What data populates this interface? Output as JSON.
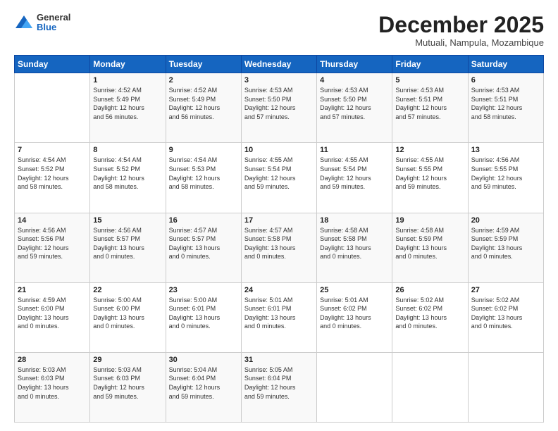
{
  "logo": {
    "general": "General",
    "blue": "Blue"
  },
  "header": {
    "month": "December 2025",
    "location": "Mutuali, Nampula, Mozambique"
  },
  "weekdays": [
    "Sunday",
    "Monday",
    "Tuesday",
    "Wednesday",
    "Thursday",
    "Friday",
    "Saturday"
  ],
  "weeks": [
    [
      {
        "day": "",
        "info": ""
      },
      {
        "day": "1",
        "info": "Sunrise: 4:52 AM\nSunset: 5:49 PM\nDaylight: 12 hours\nand 56 minutes."
      },
      {
        "day": "2",
        "info": "Sunrise: 4:52 AM\nSunset: 5:49 PM\nDaylight: 12 hours\nand 56 minutes."
      },
      {
        "day": "3",
        "info": "Sunrise: 4:53 AM\nSunset: 5:50 PM\nDaylight: 12 hours\nand 57 minutes."
      },
      {
        "day": "4",
        "info": "Sunrise: 4:53 AM\nSunset: 5:50 PM\nDaylight: 12 hours\nand 57 minutes."
      },
      {
        "day": "5",
        "info": "Sunrise: 4:53 AM\nSunset: 5:51 PM\nDaylight: 12 hours\nand 57 minutes."
      },
      {
        "day": "6",
        "info": "Sunrise: 4:53 AM\nSunset: 5:51 PM\nDaylight: 12 hours\nand 58 minutes."
      }
    ],
    [
      {
        "day": "7",
        "info": "Sunrise: 4:54 AM\nSunset: 5:52 PM\nDaylight: 12 hours\nand 58 minutes."
      },
      {
        "day": "8",
        "info": "Sunrise: 4:54 AM\nSunset: 5:52 PM\nDaylight: 12 hours\nand 58 minutes."
      },
      {
        "day": "9",
        "info": "Sunrise: 4:54 AM\nSunset: 5:53 PM\nDaylight: 12 hours\nand 58 minutes."
      },
      {
        "day": "10",
        "info": "Sunrise: 4:55 AM\nSunset: 5:54 PM\nDaylight: 12 hours\nand 59 minutes."
      },
      {
        "day": "11",
        "info": "Sunrise: 4:55 AM\nSunset: 5:54 PM\nDaylight: 12 hours\nand 59 minutes."
      },
      {
        "day": "12",
        "info": "Sunrise: 4:55 AM\nSunset: 5:55 PM\nDaylight: 12 hours\nand 59 minutes."
      },
      {
        "day": "13",
        "info": "Sunrise: 4:56 AM\nSunset: 5:55 PM\nDaylight: 12 hours\nand 59 minutes."
      }
    ],
    [
      {
        "day": "14",
        "info": "Sunrise: 4:56 AM\nSunset: 5:56 PM\nDaylight: 12 hours\nand 59 minutes."
      },
      {
        "day": "15",
        "info": "Sunrise: 4:56 AM\nSunset: 5:57 PM\nDaylight: 13 hours\nand 0 minutes."
      },
      {
        "day": "16",
        "info": "Sunrise: 4:57 AM\nSunset: 5:57 PM\nDaylight: 13 hours\nand 0 minutes."
      },
      {
        "day": "17",
        "info": "Sunrise: 4:57 AM\nSunset: 5:58 PM\nDaylight: 13 hours\nand 0 minutes."
      },
      {
        "day": "18",
        "info": "Sunrise: 4:58 AM\nSunset: 5:58 PM\nDaylight: 13 hours\nand 0 minutes."
      },
      {
        "day": "19",
        "info": "Sunrise: 4:58 AM\nSunset: 5:59 PM\nDaylight: 13 hours\nand 0 minutes."
      },
      {
        "day": "20",
        "info": "Sunrise: 4:59 AM\nSunset: 5:59 PM\nDaylight: 13 hours\nand 0 minutes."
      }
    ],
    [
      {
        "day": "21",
        "info": "Sunrise: 4:59 AM\nSunset: 6:00 PM\nDaylight: 13 hours\nand 0 minutes."
      },
      {
        "day": "22",
        "info": "Sunrise: 5:00 AM\nSunset: 6:00 PM\nDaylight: 13 hours\nand 0 minutes."
      },
      {
        "day": "23",
        "info": "Sunrise: 5:00 AM\nSunset: 6:01 PM\nDaylight: 13 hours\nand 0 minutes."
      },
      {
        "day": "24",
        "info": "Sunrise: 5:01 AM\nSunset: 6:01 PM\nDaylight: 13 hours\nand 0 minutes."
      },
      {
        "day": "25",
        "info": "Sunrise: 5:01 AM\nSunset: 6:02 PM\nDaylight: 13 hours\nand 0 minutes."
      },
      {
        "day": "26",
        "info": "Sunrise: 5:02 AM\nSunset: 6:02 PM\nDaylight: 13 hours\nand 0 minutes."
      },
      {
        "day": "27",
        "info": "Sunrise: 5:02 AM\nSunset: 6:02 PM\nDaylight: 13 hours\nand 0 minutes."
      }
    ],
    [
      {
        "day": "28",
        "info": "Sunrise: 5:03 AM\nSunset: 6:03 PM\nDaylight: 13 hours\nand 0 minutes."
      },
      {
        "day": "29",
        "info": "Sunrise: 5:03 AM\nSunset: 6:03 PM\nDaylight: 12 hours\nand 59 minutes."
      },
      {
        "day": "30",
        "info": "Sunrise: 5:04 AM\nSunset: 6:04 PM\nDaylight: 12 hours\nand 59 minutes."
      },
      {
        "day": "31",
        "info": "Sunrise: 5:05 AM\nSunset: 6:04 PM\nDaylight: 12 hours\nand 59 minutes."
      },
      {
        "day": "",
        "info": ""
      },
      {
        "day": "",
        "info": ""
      },
      {
        "day": "",
        "info": ""
      }
    ]
  ]
}
